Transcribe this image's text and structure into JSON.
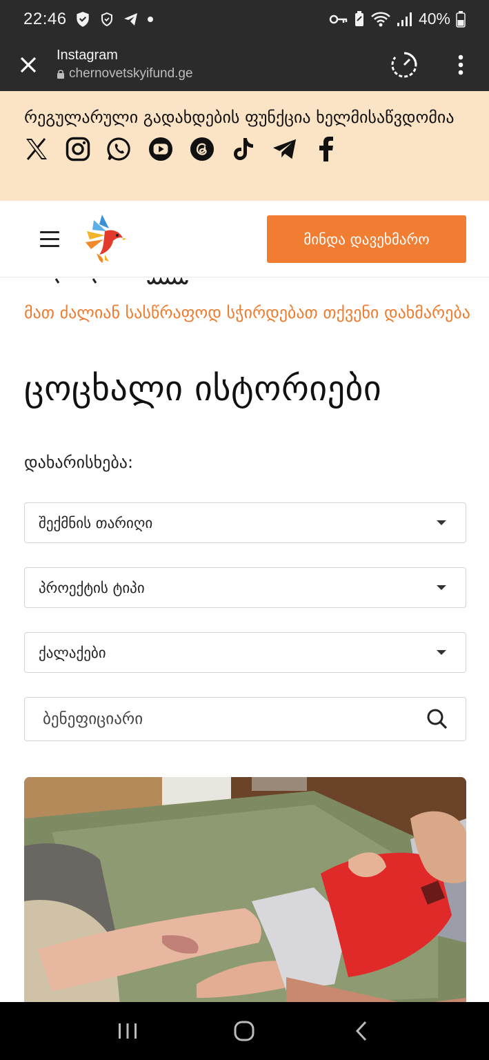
{
  "status_bar": {
    "time": "22:46",
    "battery": "40%"
  },
  "tab_header": {
    "title": "Instagram",
    "url": "chernovetskyifund.ge"
  },
  "banner": {
    "text": "რეგულარული გადახდების ფუნქცია ხელმისაწვდომია",
    "social_icons": [
      "x-icon",
      "instagram-icon",
      "whatsapp-icon",
      "youtube-icon",
      "threads-icon",
      "tiktok-icon",
      "telegram-icon",
      "facebook-icon"
    ]
  },
  "header": {
    "cta_label": "მინდა დავეხმარო"
  },
  "content": {
    "urgent_text": "მათ ძალიან სასწრაფოდ სჭირდებათ თქვენი დახმარება",
    "page_title": "ცოცხალი ისტორიები",
    "sort_label": "დახარისხება:",
    "filters": {
      "date": "შექმნის თარიღი",
      "project_type": "პროექტის ტიპი",
      "cities": "ქალაქები"
    },
    "search_placeholder": "ბენეფიციარი"
  },
  "colors": {
    "accent": "#f07d32",
    "banner_bg": "#fbe4c6",
    "dark_bar": "#2b2b2b"
  }
}
